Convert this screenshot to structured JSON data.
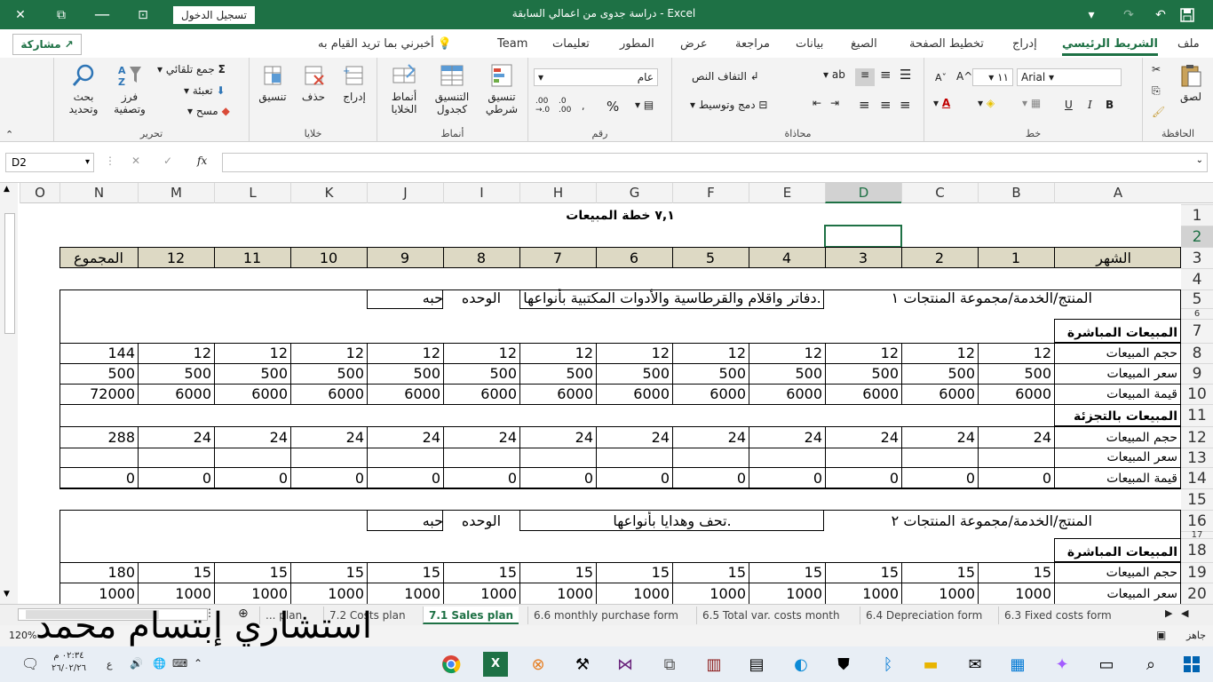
{
  "titlebar": {
    "title": "دراسة جدوى من اعمالي السابقة  -  Excel",
    "signin": "تسجيل الدخول",
    "close": "✕",
    "restore": "⧉",
    "collapse": "⊡",
    "minimize": "—"
  },
  "tabs": [
    "ملف",
    "الشريط الرئيسي",
    "إدراج",
    "تخطيط الصفحة",
    "الصيغ",
    "بيانات",
    "مراجعة",
    "عرض",
    "المطور",
    "تعليمات",
    "Team"
  ],
  "tell_me": "أخبرني بما تريد القيام به",
  "share": "مشاركة",
  "ribbon": {
    "clipboard": {
      "label": "الحافظة",
      "paste": "لصق"
    },
    "font": {
      "label": "خط",
      "name": "Arial",
      "size": "١١",
      "bold": "B",
      "italic": "I",
      "underline": "U"
    },
    "alignment": {
      "label": "محاذاة",
      "wrap": "التفاف النص",
      "merge": "دمج وتوسيط"
    },
    "number": {
      "label": "رقم",
      "format": "عام",
      "percent": "%"
    },
    "styles": {
      "label": "أنماط",
      "conditional": "تنسيق شرطي",
      "table": "التنسيق كجدول",
      "cell": "أنماط الخلايا"
    },
    "cells": {
      "label": "خلايا",
      "insert": "إدراج",
      "delete": "حذف",
      "format": "تنسيق"
    },
    "editing": {
      "label": "تحرير",
      "autosum": "جمع تلقائي",
      "fill": "تعبئة",
      "clear": "مسح",
      "sort": "فرز وتصفية",
      "find": "بحث وتحديد"
    }
  },
  "namebox": "D2",
  "columns": [
    "A",
    "B",
    "C",
    "D",
    "E",
    "F",
    "G",
    "H",
    "I",
    "J",
    "K",
    "L",
    "M",
    "N",
    "O"
  ],
  "rows": [
    "1",
    "2",
    "3",
    "4",
    "5",
    "6",
    "7",
    "8",
    "9",
    "10",
    "11",
    "12",
    "13",
    "14",
    "15",
    "16",
    "17",
    "18",
    "19",
    "20"
  ],
  "sheet": {
    "title": "٧,١ خطة المبيعات",
    "month_label": "الشهر",
    "months": [
      "1",
      "2",
      "3",
      "4",
      "5",
      "6",
      "7",
      "8",
      "9",
      "10",
      "11",
      "12"
    ],
    "total_label": "المجموع",
    "p1": {
      "product_label": "المنتج/الخدمة/مجموعة المنتجات ١",
      "product": "دفاتر واقلام  والقرطاسية والأدوات المكتبية  بأنواعها.",
      "unit_label": "الوحده",
      "unit": "حبه"
    },
    "direct_label": "المبيعات المباشرة",
    "retail_label": "المبيعات بالتجزئة",
    "vol_label": "حجم المبيعات",
    "price_label": "سعر  المبيعات",
    "value_label": "قيمة المبيعات",
    "r8": [
      "12",
      "12",
      "12",
      "12",
      "12",
      "12",
      "12",
      "12",
      "12",
      "12",
      "12",
      "12",
      "144"
    ],
    "r9": [
      "500",
      "500",
      "500",
      "500",
      "500",
      "500",
      "500",
      "500",
      "500",
      "500",
      "500",
      "500",
      "500"
    ],
    "r10": [
      "6000",
      "6000",
      "6000",
      "6000",
      "6000",
      "6000",
      "6000",
      "6000",
      "6000",
      "6000",
      "6000",
      "6000",
      "72000"
    ],
    "r12": [
      "24",
      "24",
      "24",
      "24",
      "24",
      "24",
      "24",
      "24",
      "24",
      "24",
      "24",
      "24",
      "288"
    ],
    "r14": [
      "0",
      "0",
      "0",
      "0",
      "0",
      "0",
      "0",
      "0",
      "0",
      "0",
      "0",
      "0",
      "0"
    ],
    "p2": {
      "product_label": "المنتج/الخدمة/مجموعة المنتجات ٢",
      "product": "تحف وهدايا  بأنواعها.",
      "unit_label": "الوحده",
      "unit": "حبه"
    },
    "r19": [
      "15",
      "15",
      "15",
      "15",
      "15",
      "15",
      "15",
      "15",
      "15",
      "15",
      "15",
      "15",
      "180"
    ],
    "r20": [
      "1000",
      "1000",
      "1000",
      "1000",
      "1000",
      "1000",
      "1000",
      "1000",
      "1000",
      "1000",
      "1000",
      "1000",
      "1000"
    ]
  },
  "sheet_tabs": [
    "... plan",
    "7.2 Costs plan",
    "7.1 Sales plan",
    "6.6 monthly purchase form",
    "6.5 Total var. costs month",
    "6.4 Depreciation form",
    "6.3 Fixed costs form"
  ],
  "status": {
    "ready": "جاهز",
    "zoom": "120%"
  },
  "clock": {
    "time": "٠٢:٣٤ م",
    "date": "٢٦/٠٢/٢٦"
  },
  "signature": "استشاري  إبتسام  محمد"
}
